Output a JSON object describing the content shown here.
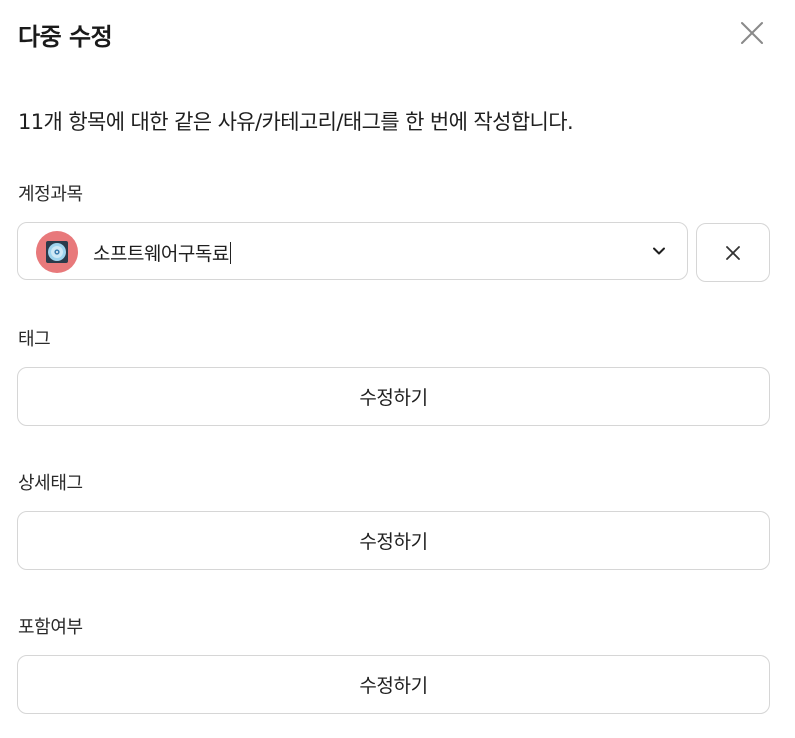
{
  "dialog": {
    "title": "다중 수정",
    "description": "11개 항목에 대한 같은 사유/카테고리/태그를 한 번에 작성합니다."
  },
  "account": {
    "label": "계정과목",
    "selected_value": "소프트웨어구독료",
    "icon": "disc-icon",
    "icon_bg_color": "#e8797b"
  },
  "tag": {
    "label": "태그",
    "button_label": "수정하기"
  },
  "detail_tag": {
    "label": "상세태그",
    "button_label": "수정하기"
  },
  "inclusion": {
    "label": "포함여부",
    "button_label": "수정하기"
  },
  "colors": {
    "border": "#d6d6d6",
    "text": "#1f1f1f"
  }
}
